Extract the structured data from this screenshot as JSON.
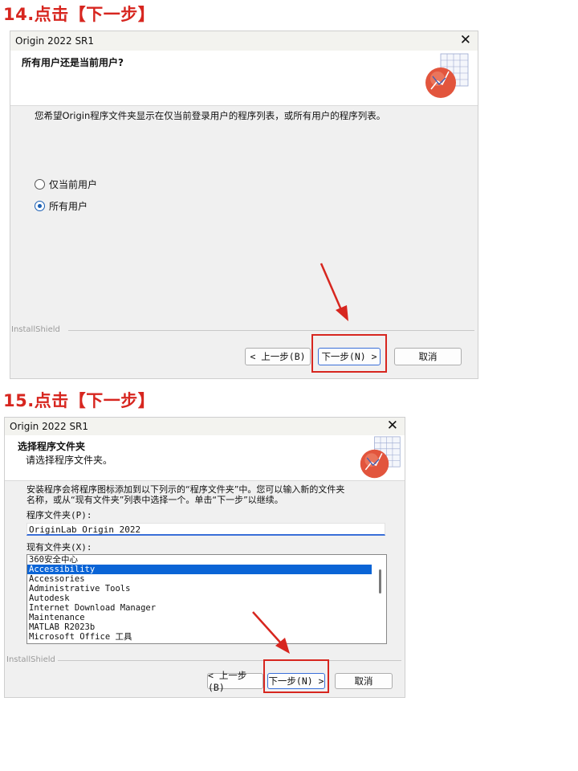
{
  "step14": {
    "heading": "14.点击【下一步】",
    "window_title": "Origin 2022 SR1",
    "close_glyph": "✕",
    "header_title": "所有用户还是当前用户?",
    "description": "您希望Origin程序文件夹显示在仅当前登录用户的程序列表，或所有用户的程序列表。",
    "options": [
      {
        "label": "仅当前用户",
        "selected": false
      },
      {
        "label": "所有用户",
        "selected": true
      }
    ],
    "installshield": "InstallShield",
    "buttons": {
      "back": "< 上一步(B)",
      "next": "下一步(N) >",
      "cancel": "取消"
    }
  },
  "step15": {
    "heading": "15.点击【下一步】",
    "window_title": "Origin 2022 SR1",
    "close_glyph": "✕",
    "header_title": "选择程序文件夹",
    "header_subtitle": "请选择程序文件夹。",
    "description_line1": "安装程序会将程序图标添加到以下列示的“程序文件夹”中。您可以输入新的文件夹",
    "description_line2": "名称，或从“现有文件夹”列表中选择一个。单击“下一步”以继续。",
    "program_folder_label": "程序文件夹(P):",
    "program_folder_value": "OriginLab Origin 2022",
    "existing_folders_label": "现有文件夹(X):",
    "existing_folders": [
      "360安全中心",
      "Accessibility",
      "Accessories",
      "Administrative Tools",
      "Autodesk",
      "Internet Download Manager",
      "Maintenance",
      "MATLAB R2023b",
      "Microsoft Office 工具"
    ],
    "selected_folder_index": 1,
    "installshield": "InstallShield",
    "buttons": {
      "back": "< 上一步(B)",
      "next": "下一步(N) >",
      "cancel": "取消"
    }
  },
  "colors": {
    "highlight": "#d7261f",
    "accent": "#0a64d6"
  },
  "icons": {
    "logo": "origin-logo-icon",
    "close": "close-icon",
    "arrow": "red-arrow-icon"
  }
}
